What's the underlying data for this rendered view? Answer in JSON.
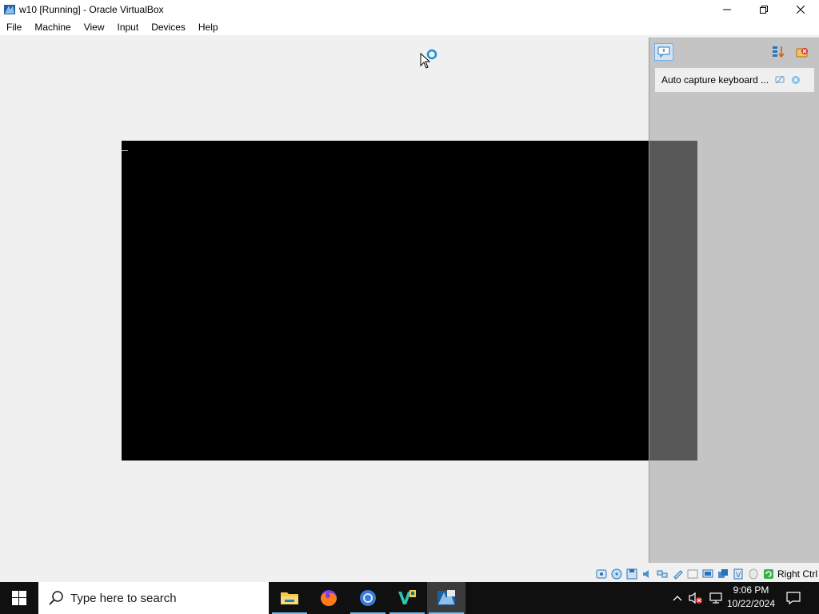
{
  "window": {
    "title": "w10 [Running] - Oracle VirtualBox"
  },
  "menubar": {
    "items": [
      {
        "label": "File"
      },
      {
        "label": "Machine"
      },
      {
        "label": "View"
      },
      {
        "label": "Input"
      },
      {
        "label": "Devices"
      },
      {
        "label": "Help"
      }
    ]
  },
  "notification": {
    "text": "Auto capture keyboard ..."
  },
  "statusbar": {
    "host_key": "Right Ctrl",
    "icons": [
      "hard-disk-icon",
      "optical-drive-icon",
      "floppy-icon",
      "audio-icon",
      "network-icon",
      "usb-icon",
      "shared-folders-icon",
      "display-icon",
      "recording-icon",
      "cpu-icon",
      "mouse-integration-icon",
      "keyboard-icon"
    ]
  },
  "taskbar": {
    "search_placeholder": "Type here to search",
    "apps": [
      "file-explorer-icon",
      "firefox-icon",
      "chrome-icon",
      "visual-studio-icon",
      "virtualbox-icon"
    ],
    "active_app": "virtualbox-icon",
    "time": "9:06 PM",
    "date": "10/22/2024"
  },
  "colors": {
    "taskbar_bg": "#101010",
    "vm_screen": "#000000",
    "accent": "#76b9ed"
  }
}
